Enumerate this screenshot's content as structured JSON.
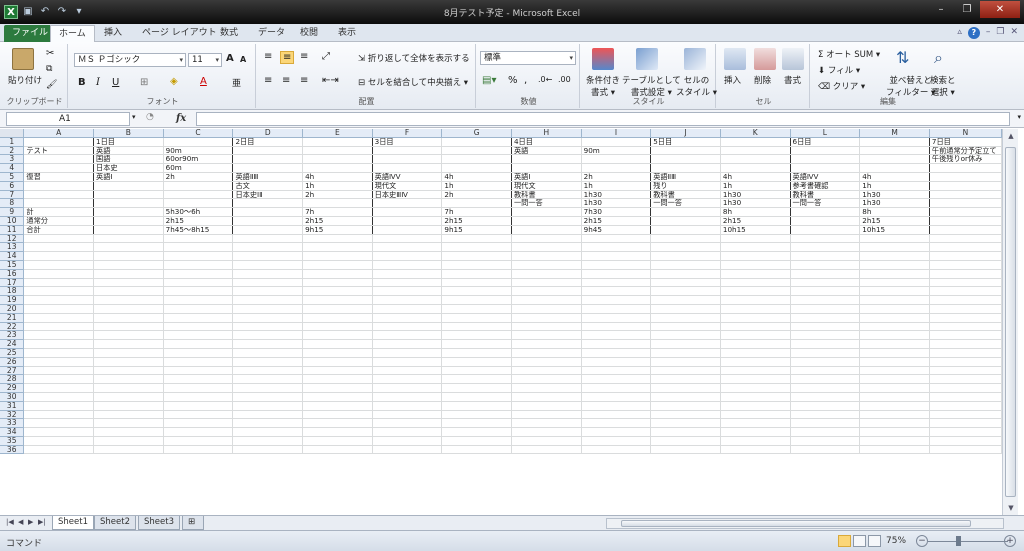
{
  "window": {
    "title": "8月テスト予定 - Microsoft Excel",
    "minimize": "–",
    "restore": "❐",
    "close": "✕"
  },
  "ribbon_tabs": [
    "ファイル",
    "ホーム",
    "挿入",
    "ページ レイアウト",
    "数式",
    "データ",
    "校閲",
    "表示"
  ],
  "ribbon": {
    "clipboard": {
      "paste": "貼り付け",
      "label": "クリップボード"
    },
    "font": {
      "name": "ＭＳ Ｐゴシック",
      "size": "11",
      "bold": "B",
      "italic": "I",
      "underline": "U",
      "grow": "A",
      "shrink": "A",
      "fontcolor": "A",
      "label": "フォント"
    },
    "alignment": {
      "wrap": "折り返して全体を表示する",
      "merge": "セルを結合して中央揃え",
      "label": "配置"
    },
    "number": {
      "format": "標準",
      "percent": "%",
      "comma": ",",
      "label": "数値"
    },
    "styles": {
      "conditional": "条件付き\n書式",
      "table": "テーブルとして\n書式設定",
      "cell": "セルの\nスタイル",
      "cond1": "条件付き",
      "cond2": "書式 ▾",
      "table1": "テーブルとして",
      "table2": "書式設定 ▾",
      "cell1": "セルの",
      "cell2": "スタイル ▾",
      "label": "スタイル"
    },
    "cells": {
      "insert": "挿入",
      "delete": "削除",
      "format": "書式",
      "label": "セル"
    },
    "editing": {
      "autosum": "Σ オート SUM ▾",
      "fill": "フィル ▾",
      "clear": "クリア ▾",
      "sort1": "並べ替えと",
      "sort2": "フィルター ▾",
      "find1": "検索と",
      "find2": "選択 ▾",
      "label": "編集"
    }
  },
  "formula_bar": {
    "name_box": "A1",
    "fx": "fx",
    "value": ""
  },
  "columns": [
    "A",
    "B",
    "C",
    "D",
    "E",
    "F",
    "G",
    "H",
    "I",
    "J",
    "K",
    "L",
    "M",
    "N"
  ],
  "rows": [
    [
      "",
      "1日目",
      "",
      "2日目",
      "",
      "3日目",
      "",
      "4日目",
      "",
      "5日目",
      "",
      "6日目",
      "",
      "7日目"
    ],
    [
      "テスト",
      "英語",
      "90m",
      "",
      "",
      "",
      "",
      "英語",
      "90m",
      "",
      "",
      "",
      "",
      "午前通常分予定立て"
    ],
    [
      "",
      "国語",
      "60or90m",
      "",
      "",
      "",
      "",
      "",
      "",
      "",
      "",
      "",
      "",
      "午後残りor休み"
    ],
    [
      "",
      "日本史",
      "60m",
      "",
      "",
      "",
      "",
      "",
      "",
      "",
      "",
      "",
      "",
      ""
    ],
    [
      "復習",
      "英語Ⅰ",
      "2h",
      "英語ⅡⅢ",
      "4h",
      "英語ⅣⅤ",
      "4h",
      "英語Ⅰ",
      "2h",
      "英語ⅡⅢ",
      "4h",
      "英語ⅣⅤ",
      "4h",
      ""
    ],
    [
      "",
      "",
      "",
      "古文",
      "1h",
      "現代文",
      "1h",
      "現代文",
      "1h",
      "残り",
      "1h",
      "参考書確認",
      "1h",
      ""
    ],
    [
      "",
      "",
      "",
      "日本史ⅠⅡ",
      "2h",
      "日本史ⅢⅣ",
      "2h",
      "教科書",
      "1h30",
      "教科書",
      "1h30",
      "教科書",
      "1h30",
      ""
    ],
    [
      "",
      "",
      "",
      "",
      "",
      "",
      "",
      "一問一答",
      "1h30",
      "一問一答",
      "1h30",
      "一問一答",
      "1h30",
      ""
    ],
    [
      "計",
      "",
      "5h30〜6h",
      "",
      "7h",
      "",
      "7h",
      "",
      "7h30",
      "",
      "8h",
      "",
      "8h",
      ""
    ],
    [
      "通常分",
      "",
      "2h15",
      "",
      "2h15",
      "",
      "2h15",
      "",
      "2h15",
      "",
      "2h15",
      "",
      "2h15",
      ""
    ],
    [
      "合計",
      "",
      "7h45〜8h15",
      "",
      "9h15",
      "",
      "9h15",
      "",
      "9h45",
      "",
      "10h15",
      "",
      "10h15",
      ""
    ]
  ],
  "total_rows": 36,
  "sheet_tabs": [
    "Sheet1",
    "Sheet2",
    "Sheet3"
  ],
  "status": {
    "mode": "コマンド",
    "zoom": "75%"
  }
}
